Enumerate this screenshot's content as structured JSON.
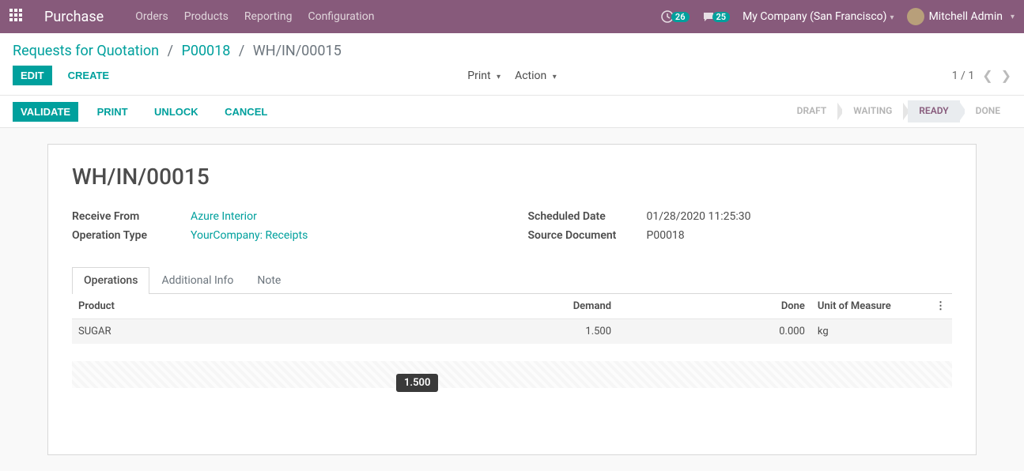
{
  "navbar": {
    "brand": "Purchase",
    "menu": [
      "Orders",
      "Products",
      "Reporting",
      "Configuration"
    ],
    "activity_count": "26",
    "msg_count": "25",
    "company": "My Company (San Francisco)",
    "user": "Mitchell Admin"
  },
  "breadcrumbs": {
    "items": [
      "Requests for Quotation",
      "P00018"
    ],
    "current": "WH/IN/00015"
  },
  "toolbar": {
    "edit": "EDIT",
    "create": "CREATE",
    "print": "Print",
    "action": "Action",
    "pager_from": "1",
    "pager_to": "1"
  },
  "statusbar": {
    "validate": "VALIDATE",
    "print": "PRINT",
    "unlock": "UNLOCK",
    "cancel": "CANCEL",
    "steps": [
      "DRAFT",
      "WAITING",
      "READY",
      "DONE"
    ],
    "active_step": "READY"
  },
  "record": {
    "title": "WH/IN/00015",
    "receive_from_label": "Receive From",
    "receive_from": "Azure Interior",
    "operation_type_label": "Operation Type",
    "operation_type": "YourCompany: Receipts",
    "scheduled_date_label": "Scheduled Date",
    "scheduled_date": "01/28/2020 11:25:30",
    "source_doc_label": "Source Document",
    "source_doc": "P00018"
  },
  "tabs": [
    "Operations",
    "Additional Info",
    "Note"
  ],
  "table": {
    "headers": {
      "product": "Product",
      "demand": "Demand",
      "done": "Done",
      "uom": "Unit of Measure"
    },
    "rows": [
      {
        "product": "SUGAR",
        "demand": "1.500",
        "done": "0.000",
        "uom": "kg"
      }
    ]
  },
  "tooltip": "1.500"
}
